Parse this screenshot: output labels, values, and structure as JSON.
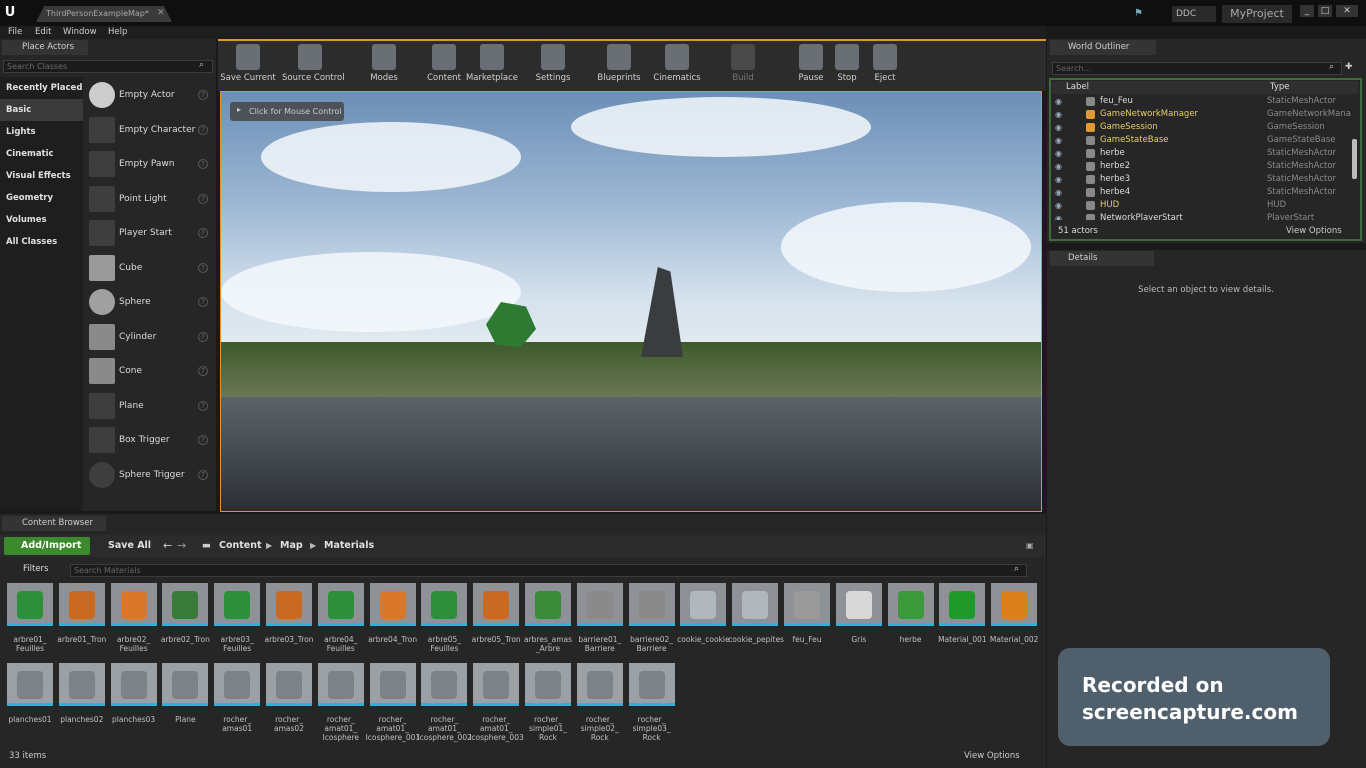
{
  "titlebar": {
    "doc_tab": "ThirdPersonExampleMap*",
    "ddc": "DDC",
    "project": "MyProject"
  },
  "menu": [
    "File",
    "Edit",
    "Window",
    "Help"
  ],
  "place_actors": {
    "tab": "Place Actors",
    "search_placeholder": "Search Classes",
    "categories": [
      "Recently Placed",
      "Basic",
      "Lights",
      "Cinematic",
      "Visual Effects",
      "Geometry",
      "Volumes",
      "All Classes"
    ],
    "active_category": "Basic",
    "actors": [
      "Empty Actor",
      "Empty Character",
      "Empty Pawn",
      "Point Light",
      "Player Start",
      "Cube",
      "Sphere",
      "Cylinder",
      "Cone",
      "Plane",
      "Box Trigger",
      "Sphere Trigger"
    ],
    "help": "?"
  },
  "toolbar": {
    "buttons": [
      "Save Current",
      "Source Control",
      "Modes",
      "Content",
      "Marketplace",
      "Settings",
      "Blueprints",
      "Cinematics",
      "Build",
      "Pause",
      "Stop",
      "Eject"
    ]
  },
  "viewport": {
    "hint": "Click for Mouse Control"
  },
  "outliner": {
    "tab": "World Outliner",
    "search_placeholder": "Search...",
    "col_label": "Label",
    "col_type": "Type",
    "rows": [
      {
        "label": "feu_Feu",
        "type": "StaticMeshActor"
      },
      {
        "label": "GameNetworkManager",
        "type": "GameNetworkManage"
      },
      {
        "label": "GameSession",
        "type": "GameSession"
      },
      {
        "label": "GameStateBase",
        "type": "GameStateBase"
      },
      {
        "label": "herbe",
        "type": "StaticMeshActor"
      },
      {
        "label": "herbe2",
        "type": "StaticMeshActor"
      },
      {
        "label": "herbe3",
        "type": "StaticMeshActor"
      },
      {
        "label": "herbe4",
        "type": "StaticMeshActor"
      },
      {
        "label": "HUD",
        "type": "HUD"
      },
      {
        "label": "NetworkPlayerStart",
        "type": "PlayerStart"
      }
    ],
    "count": "51 actors",
    "view_options": "View Options"
  },
  "details": {
    "tab": "Details",
    "empty": "Select an object to view details."
  },
  "content_browser": {
    "tab": "Content Browser",
    "add_import": "Add/Import",
    "save_all": "Save All",
    "breadcrumbs": [
      "Content",
      "Map",
      "Materials"
    ],
    "filters": "Filters",
    "search_placeholder": "Search Materials",
    "assets_row1": [
      "arbre01_\nFeuilles",
      "arbre01_Tron",
      "arbre02_\nFeuilles",
      "arbre02_Tron",
      "arbre03_\nFeuilles",
      "arbre03_Tron",
      "arbre04_\nFeuilles",
      "arbre04_Tron",
      "arbre05_\nFeuilles",
      "arbre05_Tron",
      "arbres_amas\n_Arbre",
      "barriere01_\nBarriere",
      "barriere02_\nBarriere",
      "cookie_cookie",
      "cookie_pepites",
      "feu_Feu",
      "Gris",
      "herbe",
      "Material_001",
      "Material_002"
    ],
    "assets_row2": [
      "planches01",
      "planches02",
      "planches03",
      "Plane",
      "rocher_\namas01",
      "rocher_\namas02",
      "rocher_\namat01_\nIcosphere",
      "rocher_\namat01_\nIcosphere_001",
      "rocher_\namat01_\nIcosphere_002",
      "rocher_\namat01_\nIcosphere_003",
      "rocher_\nsimple01_\nRock",
      "rocher_\nsimple02_\nRock",
      "rocher_\nsimple03_\nRock"
    ],
    "item_count": "33 items",
    "view_options": "View Options"
  },
  "watermark": "Recorded on\nscreencapture.com",
  "colors": {
    "accent": "#d99a1e",
    "add_button": "#3d8a2e",
    "asset_underline": "#2ab4d6"
  }
}
